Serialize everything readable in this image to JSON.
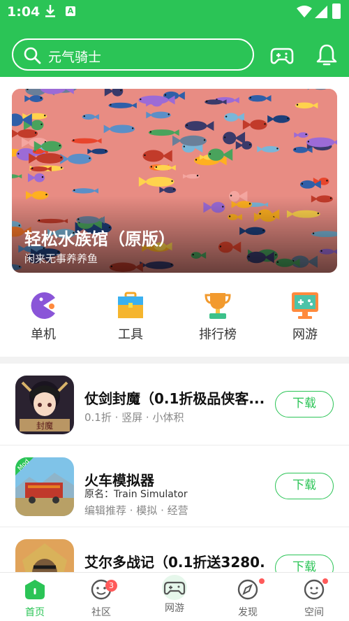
{
  "status_bar": {
    "time": "1:04"
  },
  "search": {
    "query": "元气骑士"
  },
  "banner": {
    "title": "轻松水族馆（原版）",
    "subtitle": "闲来无事养养鱼"
  },
  "categories": [
    {
      "label": "单机",
      "icon": "pacman-icon"
    },
    {
      "label": "工具",
      "icon": "toolbox-icon"
    },
    {
      "label": "排行榜",
      "icon": "trophy-icon"
    },
    {
      "label": "网游",
      "icon": "monitor-gamepad-icon"
    }
  ],
  "games": [
    {
      "name": "仗剑封魔（0.1折极品侠客...",
      "tags": "0.1折 · 竖屏 · 小体积",
      "button": "下载"
    },
    {
      "name": "火车模拟器",
      "original_name": "原名：Train Simulator",
      "tags": "编辑推荐 · 模拟 · 经营",
      "button": "下载",
      "badge": "Mod"
    },
    {
      "name": "艾尔多战记（0.1折送3280...",
      "button": "下载"
    }
  ],
  "bottom_nav": [
    {
      "label": "首页",
      "active": true
    },
    {
      "label": "社区",
      "badge": "3"
    },
    {
      "label": "网游"
    },
    {
      "label": "发现"
    },
    {
      "label": "空间"
    }
  ],
  "colors": {
    "accent": "#2bc456",
    "badge": "#ff5a5a"
  }
}
